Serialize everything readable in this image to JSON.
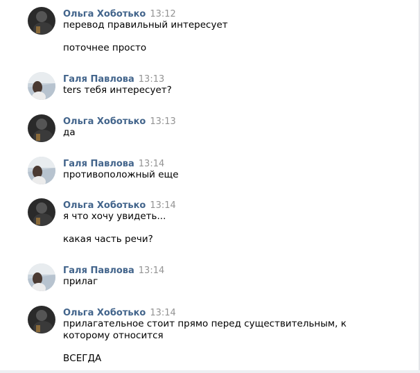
{
  "messages": [
    {
      "author": "Ольга Хоботько",
      "avatar": "olga-avatar",
      "time": "13:12",
      "lines": [
        "перевод правильный интересует",
        "поточнее просто"
      ]
    },
    {
      "author": "Галя Павлова",
      "avatar": "galya-avatar",
      "time": "13:13",
      "lines": [
        "ters тебя интересует?"
      ]
    },
    {
      "author": "Ольга Хоботько",
      "avatar": "olga-avatar",
      "time": "13:13",
      "lines": [
        "да"
      ]
    },
    {
      "author": "Галя Павлова",
      "avatar": "galya-avatar",
      "time": "13:14",
      "lines": [
        "противоположный еще"
      ]
    },
    {
      "author": "Ольга Хоботько",
      "avatar": "olga-avatar",
      "time": "13:14",
      "lines": [
        "я что хочу увидеть...",
        "какая часть речи?"
      ]
    },
    {
      "author": "Галя Павлова",
      "avatar": "galya-avatar",
      "time": "13:14",
      "lines": [
        "прилаг"
      ]
    },
    {
      "author": "Ольга Хоботько",
      "avatar": "olga-avatar",
      "time": "13:14",
      "lines": [
        "прилагательное стоит прямо перед существительным, к которому относится",
        "ВСЕГДА"
      ]
    }
  ],
  "colors": {
    "author": "#42648b",
    "time": "#939393",
    "text": "#000000"
  }
}
